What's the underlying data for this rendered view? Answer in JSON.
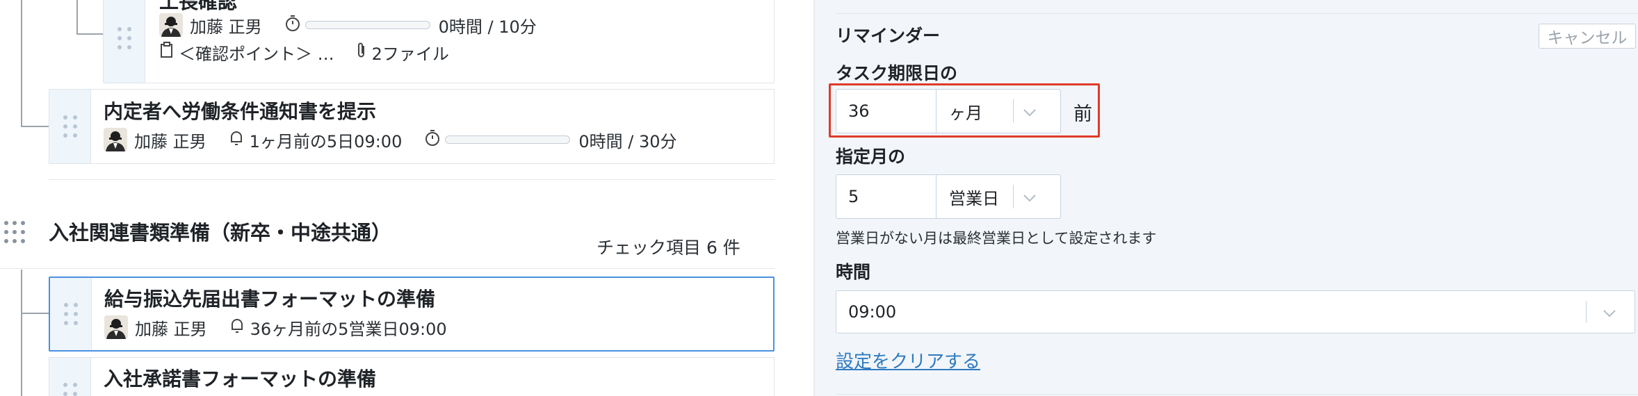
{
  "left_pane": {
    "tasks": [
      {
        "title": "工長確認",
        "assignee": "加藤 正男",
        "time": "0時間 / 10分",
        "note": "＜確認ポイント＞ …",
        "attachments": "2ファイル",
        "progress": 0
      },
      {
        "title": "内定者へ労働条件通知書を提示",
        "assignee": "加藤 正男",
        "reminder": "1ヶ月前の5日09:00",
        "time": "0時間 / 30分",
        "progress": 0
      }
    ],
    "section": {
      "title": "入社関連書類準備（新卒・中途共通）",
      "count": "チェック項目 6 件",
      "tasks": [
        {
          "title": "給与振込先届出書フォーマットの準備",
          "assignee": "加藤 正男",
          "reminder": "36ヶ月前の5営業日09:00",
          "selected": true
        },
        {
          "title": "入社承諾書フォーマットの準備"
        }
      ]
    }
  },
  "reminder_panel": {
    "heading": "リマインダー",
    "cancel_label": "キャンセル",
    "deadline_label": "タスク期限日の",
    "offset_value": "36",
    "offset_unit": "ヶ月",
    "offset_suffix": "前",
    "month_label": "指定月の",
    "day_value": "5",
    "day_unit": "営業日",
    "note": "営業日がない月は最終営業日として設定されます",
    "time_label": "時間",
    "time_value": "09:00",
    "clear_link": "設定をクリアする"
  },
  "colors": {
    "accent_link": "#2f7ac0",
    "highlight": "#e03a2a",
    "selected_border": "#4a90e2",
    "panel_bg": "#f2f6fa"
  },
  "icons": [
    "avatar",
    "timer-icon",
    "bell-icon",
    "memo-icon",
    "paperclip-icon",
    "drag-handle-icon",
    "chevron-down-icon"
  ]
}
